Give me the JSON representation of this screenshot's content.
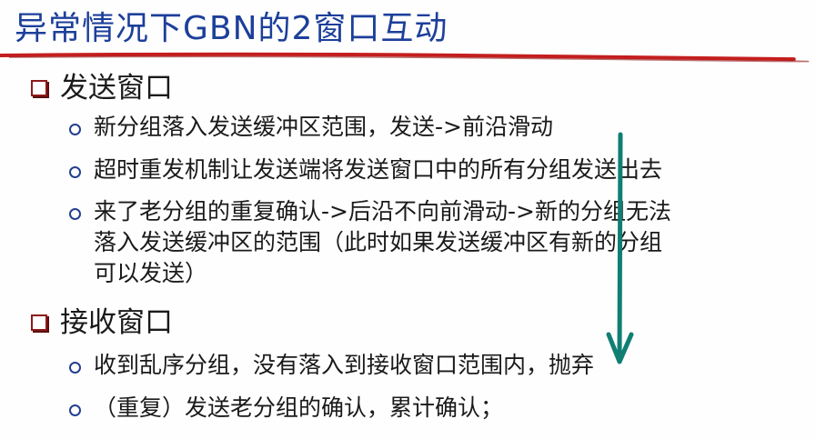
{
  "slide": {
    "title": "异常情况下GBN的2窗口互动",
    "sections": [
      {
        "heading": "发送窗口",
        "items": [
          {
            "lines": [
              "新分组落入发送缓冲区范围，发送->前沿滑动"
            ]
          },
          {
            "lines": [
              "超时重发机制让发送端将发送窗口中的所有分组发送出去"
            ]
          },
          {
            "lines": [
              "来了老分组的重复确认->后沿不向前滑动->新的分组无法",
              "落入发送缓冲区的范围（此时如果发送缓冲区有新的分组",
              "可以发送）"
            ]
          }
        ]
      },
      {
        "heading": "接收窗口",
        "items": [
          {
            "lines": [
              "收到乱序分组，没有落入到接收窗口范围内，抛弃"
            ]
          },
          {
            "lines": [
              "（重复）发送老分组的确认，累计确认；"
            ]
          }
        ]
      }
    ],
    "colors": {
      "title": "#1c3f9a",
      "underline": "#c41e1e",
      "section_bullet": "#8c1919",
      "item_bullet": "#243f8f",
      "annotation_arrow": "#0f7f73"
    },
    "icons": {
      "section_bullet": "square-bullet-icon",
      "item_bullet": "circle-bullet-icon",
      "annotation": "down-arrow-icon"
    }
  }
}
